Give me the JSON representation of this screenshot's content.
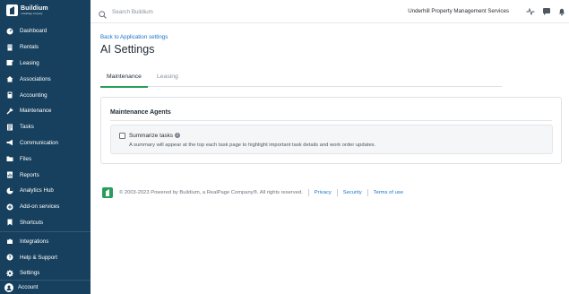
{
  "brand": {
    "name": "Buildium",
    "tagline": "a RealPage Company"
  },
  "sidebar": {
    "items": [
      {
        "label": "Dashboard",
        "icon": "dashboard-icon"
      },
      {
        "label": "Rentals",
        "icon": "building-icon"
      },
      {
        "label": "Leasing",
        "icon": "leasing-icon"
      },
      {
        "label": "Associations",
        "icon": "associations-icon"
      },
      {
        "label": "Accounting",
        "icon": "calculator-icon"
      },
      {
        "label": "Maintenance",
        "icon": "wrench-icon"
      },
      {
        "label": "Tasks",
        "icon": "tasks-icon"
      },
      {
        "label": "Communication",
        "icon": "megaphone-icon"
      },
      {
        "label": "Files",
        "icon": "folder-icon"
      },
      {
        "label": "Reports",
        "icon": "reports-icon"
      },
      {
        "label": "Analytics Hub",
        "icon": "analytics-icon"
      },
      {
        "label": "Add-on services",
        "icon": "addon-icon"
      },
      {
        "label": "Shortcuts",
        "icon": "bookmark-icon"
      },
      {
        "label": "Integrations",
        "icon": "puzzle-icon"
      },
      {
        "label": "Help & Support",
        "icon": "help-icon"
      },
      {
        "label": "Settings",
        "icon": "gear-icon"
      }
    ],
    "account_label": "Account"
  },
  "topbar": {
    "search_placeholder": "Search Buildium",
    "company_name": "Underhill Property Management Services"
  },
  "main": {
    "back_link": "Back to Application settings",
    "title": "AI Settings",
    "tabs": [
      {
        "label": "Maintenance",
        "active": true
      },
      {
        "label": "Leasing",
        "active": false
      }
    ],
    "section_title": "Maintenance Agents",
    "option": {
      "label": "Summarize tasks",
      "checked": false,
      "description": "A summary will appear at the top each task page to highlight important task details and work order updates."
    }
  },
  "footer": {
    "copyright": "© 2003-2023 Powered by Buildium, a RealPage Company®. All rights reserved.",
    "links": [
      "Privacy",
      "Security",
      "Terms of use"
    ]
  },
  "colors": {
    "sidebar_bg": "#16405e",
    "link": "#1a73c9",
    "tab_accent": "#2a9d5b"
  }
}
